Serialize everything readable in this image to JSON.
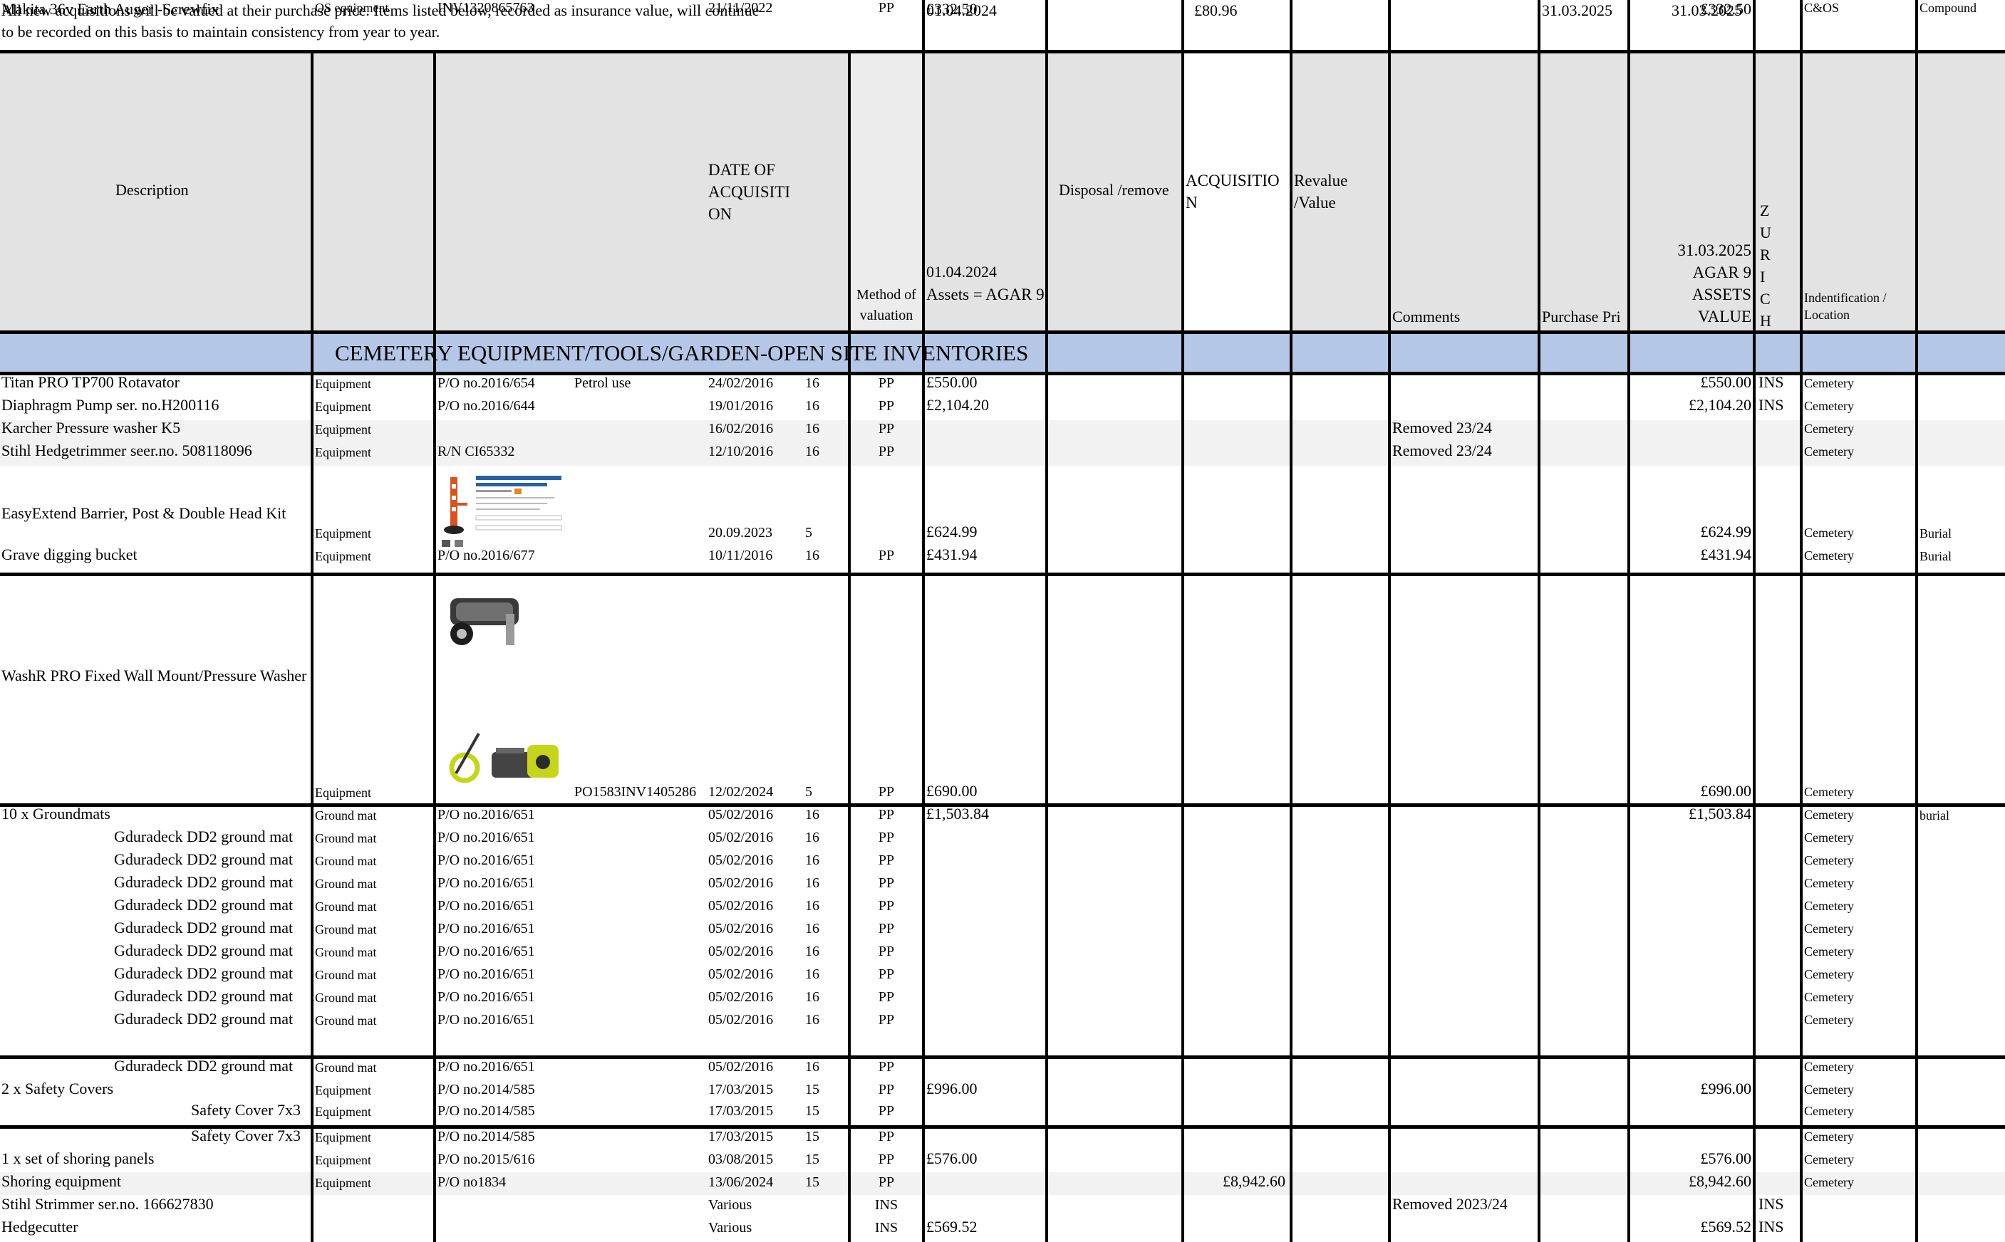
{
  "note_line1": "All new acquisitions will be valued at their purchase price. Items listed below, recorded as insurance value, will continue",
  "note_line2": "to be recorded on this basis to maintain consistency from year to year.",
  "top_values": {
    "date_start": "01.04.2024",
    "amount": "£80.96",
    "date_end_1": "31.03.2025",
    "date_end_2": "31.03.2025"
  },
  "headers": {
    "description": "Description",
    "date_of_acquisition": "DATE OF ACQUISITI ON",
    "method": "Method of valuation",
    "assets_2024_date": "01.04.2024",
    "assets_2024_label": "Assets =  AGAR 9",
    "disposal": "Disposal /remove",
    "acquisition": "ACQUISITIO N",
    "revalue": "Revalue /Value",
    "comments": "Comments",
    "purchase_price": "Purchase Pri",
    "assets_2025": "31.03.2025 AGAR 9 ASSETS VALUE",
    "zurich": "Z U R I C H",
    "identification": "Indentification / Location"
  },
  "section_title": "CEMETERY EQUIPMENT/TOOLS/GARDEN-OPEN SITE INVENTORIES",
  "rows": [
    {
      "desc": "Titan PRO TP700  Rotavator",
      "type": "Equipment",
      "ref": "P/O no.2016/654",
      "ref2": "Petrol use",
      "date": "24/02/2016",
      "life": "16",
      "method": "PP",
      "v2024": "£550.00",
      "disposal": "",
      "acq": "",
      "comments": "",
      "v2025": "£550.00",
      "ins": "INS",
      "loc": "Cemetery",
      "loc2": ""
    },
    {
      "desc": "Diaphragm Pump  ser. no.H200116",
      "type": "Equipment",
      "ref": "P/O no.2016/644",
      "ref2": "",
      "date": "19/01/2016",
      "life": "16",
      "method": "PP",
      "v2024": "£2,104.20",
      "disposal": "",
      "acq": "",
      "comments": "",
      "v2025": "£2,104.20",
      "ins": "INS",
      "loc": "Cemetery",
      "loc2": ""
    },
    {
      "desc": "Karcher Pressure washer K5",
      "type": "Equipment",
      "ref": "",
      "ref2": "",
      "date": "16/02/2016",
      "life": "16",
      "method": "PP",
      "v2024": "",
      "disposal": "",
      "acq": "",
      "comments": "Removed 23/24",
      "v2025": "",
      "ins": "",
      "loc": "Cemetery",
      "loc2": ""
    },
    {
      "desc": "Stihl Hedgetrimmer  seer.no. 508118096",
      "type": "Equipment",
      "ref": "R/N CI65332",
      "ref2": "",
      "date": "12/10/2016",
      "life": "16",
      "method": "PP",
      "v2024": "",
      "disposal": "",
      "acq": "",
      "comments": "Removed 23/24",
      "v2025": "",
      "ins": "",
      "loc": "Cemetery",
      "loc2": ""
    },
    {
      "desc": "EasyExtend Barrier, Post & Double Head Kit",
      "type": "Equipment",
      "ref": "",
      "ref2": "",
      "date": "20.09.2023",
      "life": "5",
      "method": "",
      "v2024": "£624.99",
      "disposal": "",
      "acq": "",
      "comments": "",
      "v2025": "£624.99",
      "ins": "",
      "loc": "Cemetery",
      "loc2": "Burial"
    },
    {
      "desc": "Grave digging bucket",
      "type": "Equipment",
      "ref": "P/O no.2016/677",
      "ref2": "",
      "date": "10/11/2016",
      "life": "16",
      "method": "PP",
      "v2024": "£431.94",
      "disposal": "",
      "acq": "",
      "comments": "",
      "v2025": "£431.94",
      "ins": "",
      "loc": "Cemetery",
      "loc2": "Burial"
    },
    {
      "desc": "WashR PRO Fixed Wall Mount/Pressure Washer",
      "type": "Equipment",
      "ref": "",
      "ref2": "PO1583INV1405286",
      "date": "12/02/2024",
      "life": "5",
      "method": "PP",
      "v2024": "£690.00",
      "disposal": "",
      "acq": "",
      "comments": "",
      "v2025": "£690.00",
      "ins": "",
      "loc": "Cemetery",
      "loc2": ""
    },
    {
      "desc": "10 x Groundmats",
      "type": "Ground mat",
      "ref": "P/O no.2016/651",
      "ref2": "",
      "date": "05/02/2016",
      "life": "16",
      "method": "PP",
      "v2024": "£1,503.84",
      "disposal": "",
      "acq": "",
      "comments": "",
      "v2025": "£1,503.84",
      "ins": "",
      "loc": "Cemetery",
      "loc2": "burial"
    },
    {
      "desc": "Gduradeck DD2 ground mat",
      "type": "Ground mat",
      "ref": "P/O no.2016/651",
      "ref2": "",
      "date": "05/02/2016",
      "life": "16",
      "method": "PP",
      "v2024": "",
      "disposal": "",
      "acq": "",
      "comments": "",
      "v2025": "",
      "ins": "",
      "loc": "Cemetery",
      "loc2": ""
    },
    {
      "desc": "Gduradeck DD2 ground mat",
      "type": "Ground mat",
      "ref": "P/O no.2016/651",
      "ref2": "",
      "date": "05/02/2016",
      "life": "16",
      "method": "PP",
      "v2024": "",
      "disposal": "",
      "acq": "",
      "comments": "",
      "v2025": "",
      "ins": "",
      "loc": "Cemetery",
      "loc2": ""
    },
    {
      "desc": "Gduradeck DD2 ground mat",
      "type": "Ground mat",
      "ref": "P/O no.2016/651",
      "ref2": "",
      "date": "05/02/2016",
      "life": "16",
      "method": "PP",
      "v2024": "",
      "disposal": "",
      "acq": "",
      "comments": "",
      "v2025": "",
      "ins": "",
      "loc": "Cemetery",
      "loc2": ""
    },
    {
      "desc": "Gduradeck DD2 ground mat",
      "type": "Ground mat",
      "ref": "P/O no.2016/651",
      "ref2": "",
      "date": "05/02/2016",
      "life": "16",
      "method": "PP",
      "v2024": "",
      "disposal": "",
      "acq": "",
      "comments": "",
      "v2025": "",
      "ins": "",
      "loc": "Cemetery",
      "loc2": ""
    },
    {
      "desc": "Gduradeck DD2 ground mat",
      "type": "Ground mat",
      "ref": "P/O no.2016/651",
      "ref2": "",
      "date": "05/02/2016",
      "life": "16",
      "method": "PP",
      "v2024": "",
      "disposal": "",
      "acq": "",
      "comments": "",
      "v2025": "",
      "ins": "",
      "loc": "Cemetery",
      "loc2": ""
    },
    {
      "desc": "Gduradeck DD2 ground mat",
      "type": "Ground mat",
      "ref": "P/O no.2016/651",
      "ref2": "",
      "date": "05/02/2016",
      "life": "16",
      "method": "PP",
      "v2024": "",
      "disposal": "",
      "acq": "",
      "comments": "",
      "v2025": "",
      "ins": "",
      "loc": "Cemetery",
      "loc2": ""
    },
    {
      "desc": "Gduradeck DD2 ground mat",
      "type": "Ground mat",
      "ref": "P/O no.2016/651",
      "ref2": "",
      "date": "05/02/2016",
      "life": "16",
      "method": "PP",
      "v2024": "",
      "disposal": "",
      "acq": "",
      "comments": "",
      "v2025": "",
      "ins": "",
      "loc": "Cemetery",
      "loc2": ""
    },
    {
      "desc": "Gduradeck DD2 ground mat",
      "type": "Ground mat",
      "ref": "P/O no.2016/651",
      "ref2": "",
      "date": "05/02/2016",
      "life": "16",
      "method": "PP",
      "v2024": "",
      "disposal": "",
      "acq": "",
      "comments": "",
      "v2025": "",
      "ins": "",
      "loc": "Cemetery",
      "loc2": ""
    },
    {
      "desc": "Gduradeck DD2 ground mat",
      "type": "Ground mat",
      "ref": "P/O no.2016/651",
      "ref2": "",
      "date": "05/02/2016",
      "life": "16",
      "method": "PP",
      "v2024": "",
      "disposal": "",
      "acq": "",
      "comments": "",
      "v2025": "",
      "ins": "",
      "loc": "Cemetery",
      "loc2": ""
    },
    {
      "desc": "Gduradeck DD2 ground mat",
      "type": "Ground mat",
      "ref": "P/O no.2016/651",
      "ref2": "",
      "date": "05/02/2016",
      "life": "16",
      "method": "PP",
      "v2024": "",
      "disposal": "",
      "acq": "",
      "comments": "",
      "v2025": "",
      "ins": "",
      "loc": "Cemetery",
      "loc2": ""
    },
    {
      "desc": "2 x Safety Covers",
      "type": "Equipment",
      "ref": "P/O no.2014/585",
      "ref2": "",
      "date": "17/03/2015",
      "life": "15",
      "method": "PP",
      "v2024": "£996.00",
      "disposal": "",
      "acq": "",
      "comments": "",
      "v2025": "£996.00",
      "ins": "",
      "loc": "Cemetery",
      "loc2": ""
    },
    {
      "desc": "Safety Cover 7x3",
      "type": "Equipment",
      "ref": "P/O  no.2014/585",
      "ref2": "",
      "date": "17/03/2015",
      "life": "15",
      "method": "PP",
      "v2024": "",
      "disposal": "",
      "acq": "",
      "comments": "",
      "v2025": "",
      "ins": "",
      "loc": "Cemetery",
      "loc2": ""
    },
    {
      "desc": "Safety Cover 7x3",
      "type": "Equipment",
      "ref": "P/O no.2014/585",
      "ref2": "",
      "date": "17/03/2015",
      "life": "15",
      "method": "PP",
      "v2024": "",
      "disposal": "",
      "acq": "",
      "comments": "",
      "v2025": "",
      "ins": "",
      "loc": "Cemetery",
      "loc2": ""
    },
    {
      "desc": "1 x set of shoring panels",
      "type": "Equipment",
      "ref": "P/O no.2015/616",
      "ref2": "",
      "date": "03/08/2015",
      "life": "15",
      "method": "PP",
      "v2024": "£576.00",
      "disposal": "",
      "acq": "",
      "comments": "",
      "v2025": "£576.00",
      "ins": "",
      "loc": "Cemetery",
      "loc2": ""
    },
    {
      "desc": "Shoring equipment",
      "type": "Equipment",
      "ref": "P/O no1834",
      "ref2": "",
      "date": "13/06/2024",
      "life": "15",
      "method": "PP",
      "v2024": "",
      "disposal": "",
      "acq": "£8,942.60",
      "comments": "",
      "v2025": "£8,942.60",
      "ins": "",
      "loc": "Cemetery",
      "loc2": ""
    },
    {
      "desc": "Stihl Strimmer ser.no. 166627830",
      "type": "",
      "ref": "",
      "ref2": "",
      "date": "Various",
      "life": "",
      "method": "INS",
      "v2024": "",
      "disposal": "",
      "acq": "",
      "comments": "Removed 2023/24",
      "v2025": "",
      "ins": "INS",
      "loc": "",
      "loc2": ""
    },
    {
      "desc": "Hedgecutter",
      "type": "",
      "ref": "",
      "ref2": "",
      "date": "Various",
      "life": "",
      "method": "INS",
      "v2024": "£569.52",
      "disposal": "",
      "acq": "",
      "comments": "",
      "v2025": "£569.52",
      "ins": "INS",
      "loc": "",
      "loc2": ""
    },
    {
      "desc": "Makita 36v Earth Auger -Screwfix",
      "type": "OS equipment",
      "ref": "INV1320865763",
      "ref2": "",
      "date": "21/11/2022",
      "life": "",
      "method": "PP",
      "v2024": "£332.50",
      "disposal": "",
      "acq": "",
      "comments": "",
      "v2025": "£332.50",
      "ins": "",
      "loc": "C&OS",
      "loc2": "Compound"
    }
  ]
}
